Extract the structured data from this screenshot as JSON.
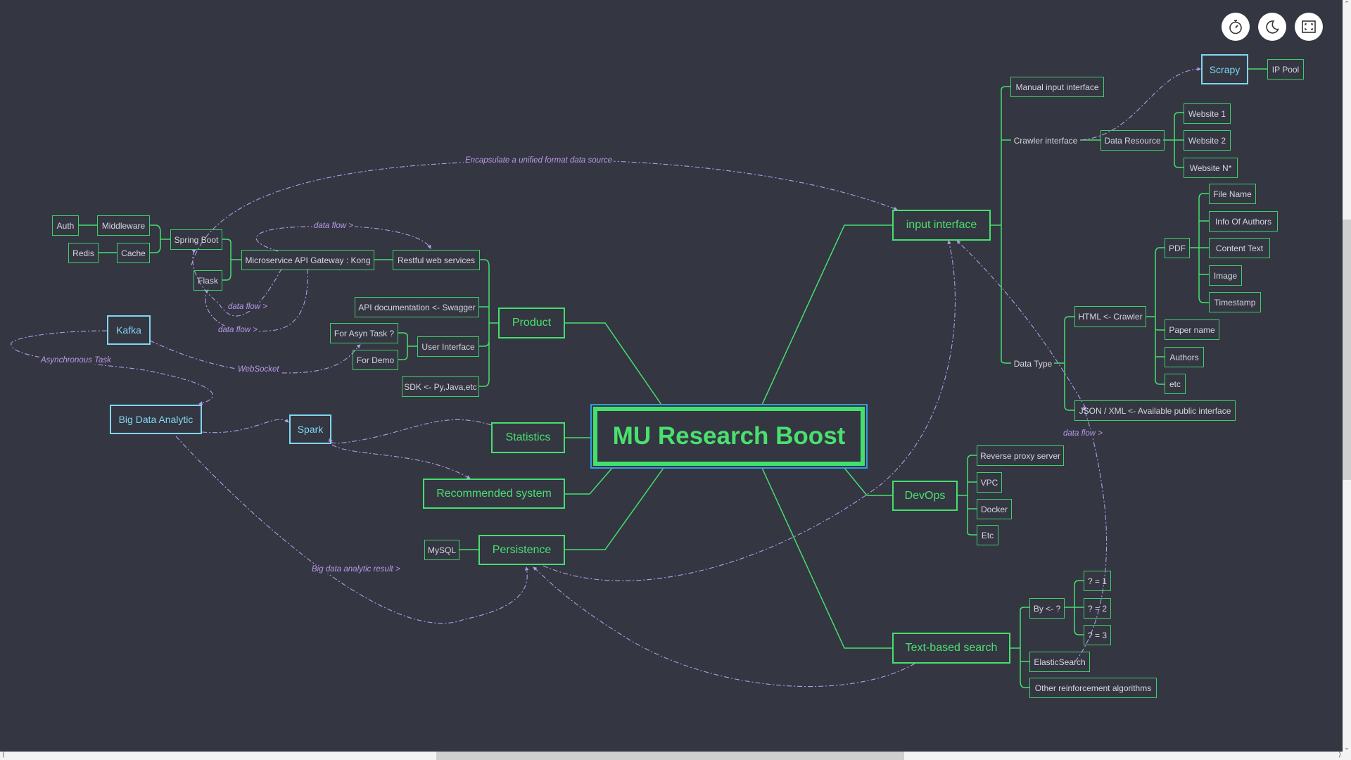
{
  "toolbar": {
    "buttons": [
      {
        "icon": "stopwatch-icon",
        "label": "Timer"
      },
      {
        "icon": "moon-icon",
        "label": "Dark mode"
      },
      {
        "icon": "fullscreen-icon",
        "label": "Fullscreen"
      }
    ]
  },
  "colors": {
    "background": "#343642",
    "branch": "#44e06c",
    "highlight": "#7fd6ef",
    "selection": "#2f9de0",
    "relation": "#b79ae8",
    "text": "#d6d6de"
  },
  "mindmap": {
    "root": "MU Research Boost",
    "branches": {
      "input_interface": {
        "label": "input interface",
        "manual": "Manual input interface",
        "crawler": "Crawler interface",
        "data_resource": "Data Resource",
        "scrapy": "Scrapy",
        "ip_pool": "IP Pool",
        "websites": [
          "Website 1",
          "Website 2",
          "Website  N*"
        ],
        "data_type": "Data Type",
        "html_crawler": "HTML <- Crawler",
        "pdf": "PDF",
        "pdf_fields": [
          "File Name",
          "Info Of Authors",
          "Content Text",
          "Image",
          "Timestamp"
        ],
        "html_fields": [
          "Paper name",
          "Authors",
          "etc"
        ],
        "json_xml": "JSON / XML <- Available public interface"
      },
      "product": {
        "label": "Product",
        "restful": "Restful web services",
        "gateway": "Microservice API Gateway : Kong",
        "spring_boot": "Spring Boot",
        "flask": "Flask",
        "middleware": "Middleware",
        "auth": "Auth",
        "cache": "Cache",
        "redis": "Redis",
        "api_doc": "API documentation <- Swagger",
        "user_interface": "User Interface",
        "for_asyn": "For Asyn Task ?",
        "for_demo": "For Demo",
        "sdk": "SDK <- Py,Java,etc"
      },
      "statistics": {
        "label": "Statistics"
      },
      "recommended": {
        "label": "Recommended system"
      },
      "persistence": {
        "label": "Persistence",
        "mysql": "MySQL"
      },
      "devops": {
        "label": "DevOps",
        "children": [
          "Reverse proxy server",
          "VPC",
          "Docker",
          "Etc"
        ]
      },
      "text_search": {
        "label": "Text-based search",
        "by": "By <-  ?",
        "by_children": [
          "? = 1",
          "? = 2",
          "? = 3"
        ],
        "elastic": "ElasticSearch",
        "other": "Other reinforcement algorithms"
      }
    },
    "floating": {
      "kafka": "Kafka",
      "big_data": "Big Data Analytic",
      "spark": "Spark"
    },
    "relations": {
      "encapsulate": "Encapsulate a unified format data source",
      "data_flow_top": "data flow >",
      "data_flow_mid": "data flow >",
      "data_flow_low": "data flow >",
      "data_flow_right": "data flow >",
      "websocket": "WebSocket",
      "async_task": "Asynchronous Task",
      "big_data_result": "Big data analytic result >"
    }
  }
}
